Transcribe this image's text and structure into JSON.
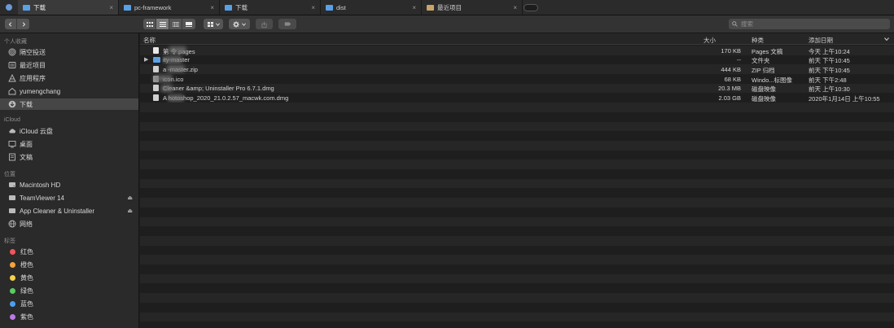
{
  "tabs": [
    {
      "label": "下载",
      "icon": "folder-icon",
      "active": true
    },
    {
      "label": "pc-framework",
      "icon": "folder-icon",
      "active": false
    },
    {
      "label": "下载",
      "icon": "folder-icon",
      "active": false
    },
    {
      "label": "dist",
      "icon": "folder-icon",
      "active": false
    },
    {
      "label": "最近项目",
      "icon": "recents-icon",
      "active": false
    }
  ],
  "tab_close_glyph": "×",
  "search": {
    "placeholder": "搜索"
  },
  "sidebar": {
    "favorites_title": "个人收藏",
    "favorites": [
      {
        "label": "隔空投送",
        "icon": "airdrop-icon"
      },
      {
        "label": "最近项目",
        "icon": "recents-icon"
      },
      {
        "label": "应用程序",
        "icon": "applications-icon"
      },
      {
        "label": "yumengchang",
        "icon": "home-icon"
      },
      {
        "label": "下载",
        "icon": "downloads-icon",
        "selected": true
      }
    ],
    "icloud_title": "iCloud",
    "icloud": [
      {
        "label": "iCloud 云盘",
        "icon": "cloud-icon"
      },
      {
        "label": "桌面",
        "icon": "desktop-icon"
      },
      {
        "label": "文稿",
        "icon": "documents-icon"
      }
    ],
    "locations_title": "位置",
    "locations": [
      {
        "label": "Macintosh HD",
        "icon": "disk-icon"
      },
      {
        "label": "TeamViewer 14",
        "icon": "disk-icon",
        "eject": true
      },
      {
        "label": "App Cleaner & Uninstaller",
        "icon": "disk-icon",
        "eject": true
      },
      {
        "label": "网络",
        "icon": "network-icon"
      }
    ],
    "tags_title": "标签",
    "tags": [
      {
        "label": "红色",
        "color": "#f0565a"
      },
      {
        "label": "橙色",
        "color": "#f3a43a"
      },
      {
        "label": "黄色",
        "color": "#f4d24a"
      },
      {
        "label": "绿色",
        "color": "#5ccb5f"
      },
      {
        "label": "蓝色",
        "color": "#4a9ff5"
      },
      {
        "label": "紫色",
        "color": "#bb7be4"
      }
    ]
  },
  "columns": {
    "name": "名称",
    "size": "大小",
    "kind": "种类",
    "date": "添加日期"
  },
  "files": [
    {
      "name": "第    令.pages",
      "size": "170 KB",
      "kind": "Pages 文稿",
      "date": "今天 上午10:24",
      "type": "doc"
    },
    {
      "name": "   ity-master",
      "size": "--",
      "kind": "文件夹",
      "date": "前天 下午10:45",
      "type": "folder"
    },
    {
      "name": "a     -master.zip",
      "size": "444 KB",
      "kind": "ZIP 归档",
      "date": "前天 下午10:45",
      "type": "zip"
    },
    {
      "name": "    icon.ico",
      "size": "68 KB",
      "kind": "Windo...标图像",
      "date": "前天 下午2:48",
      "type": "ico"
    },
    {
      "name": "    Cleaner &amp; Uninstaller Pro 6.7.1.dmg",
      "size": "20.3 MB",
      "kind": "磁盘映像",
      "date": "前天 上午10:30",
      "type": "dmg"
    },
    {
      "name": "A     hotoshop_2020_21.0.2.57_macwk.com.dmg",
      "size": "2.03 GB",
      "kind": "磁盘映像",
      "date": "2020年1月14日 上午10:55",
      "type": "dmg"
    }
  ],
  "colors": {
    "accent_folder": "#5aa0e6",
    "sidebar_bg": "#2a2a2a",
    "main_bg": "#1e1e1e"
  }
}
